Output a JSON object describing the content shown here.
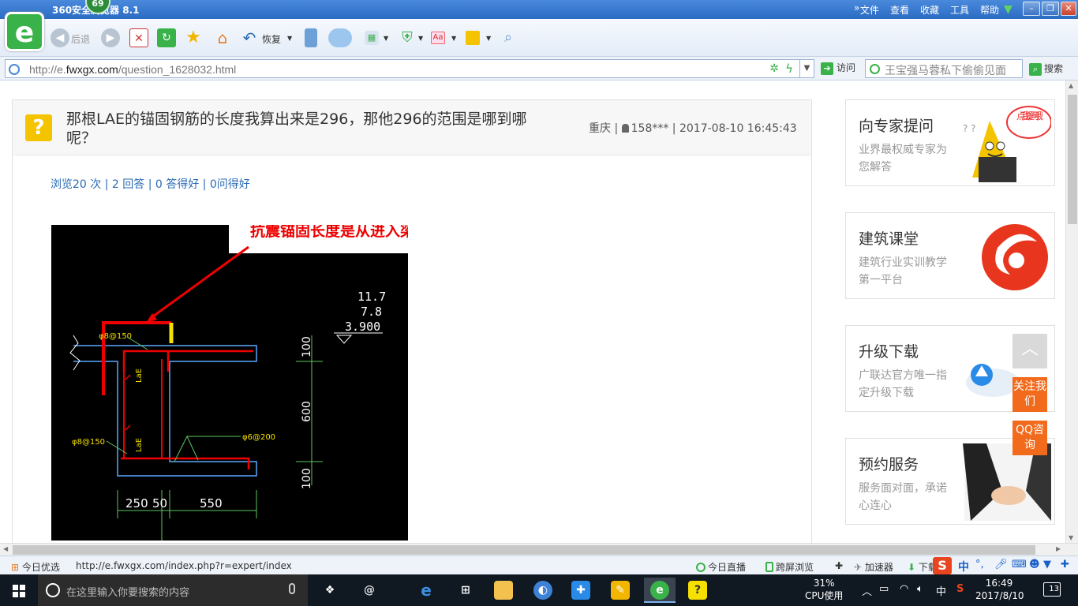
{
  "browser": {
    "title": "360安全浏览器 8.1",
    "badge": "69",
    "menus": [
      "文件",
      "查看",
      "收藏",
      "工具",
      "帮助"
    ],
    "back_label": "后退",
    "restore_label": "恢复",
    "url_dim": "http://e.",
    "url_domain": "fwxgx.com",
    "url_path": "/question_1628032.html",
    "go_label": "访问",
    "search_value": "王宝强马蓉私下偷偷见面",
    "search_label": "搜索"
  },
  "question": {
    "icon": "?",
    "title": "那根LAE的锚固钢筋的长度我算出来是296，那他296的范围是哪到哪呢？",
    "city": "重庆",
    "user": "158***",
    "date": "2017-08-10 16:45:43",
    "stats": "浏览20 次 | 2 回答 | 0 答得好 | 0问得好"
  },
  "figure": {
    "annotation": "抗震锚固长度是从进入梁开始计算",
    "levels": [
      "11.7",
      "7.8",
      "3.900"
    ],
    "rebar_top": "φ8@150",
    "rebar_left": "φ8@150",
    "rebar_right": "φ6@200",
    "lae_1": "LaE",
    "lae_2": "LaE",
    "dim_100a": "100",
    "dim_600": "600",
    "dim_100b": "100",
    "dim_250": "250",
    "dim_50": "50",
    "dim_550": "550"
  },
  "sidebar": [
    {
      "title": "向专家提问",
      "desc": "业界最权威专家为您解答",
      "bubble": "点我提问哦"
    },
    {
      "title": "建筑课堂",
      "desc": "建筑行业实训教学第一平台"
    },
    {
      "title": "升级下载",
      "desc": "广联达官方唯一指定升级下载"
    },
    {
      "title": "预约服务",
      "desc": "服务面对面，承诺心连心"
    }
  ],
  "floating": {
    "follow": "关注我们",
    "qq": "QQ咨询"
  },
  "status": {
    "today": "今日优选",
    "hover_url": "http://e.fwxgx.com/index.php?r=expert/index",
    "live": "今日直播",
    "cross_screen": "跨屏浏览",
    "accelerator": "加速器",
    "download": "下载",
    "ime_lang": "中"
  },
  "taskbar": {
    "search_placeholder": "在这里输入你要搜索的内容",
    "cpu_percent": "31%",
    "cpu_label": "CPU使用",
    "ime": "中",
    "time": "16:49",
    "date": "2017/8/10",
    "notifications": "13"
  },
  "colors": {
    "brand_green": "#3ab24a",
    "accent_orange": "#f26b1d",
    "link_blue": "#2a6bb4"
  }
}
